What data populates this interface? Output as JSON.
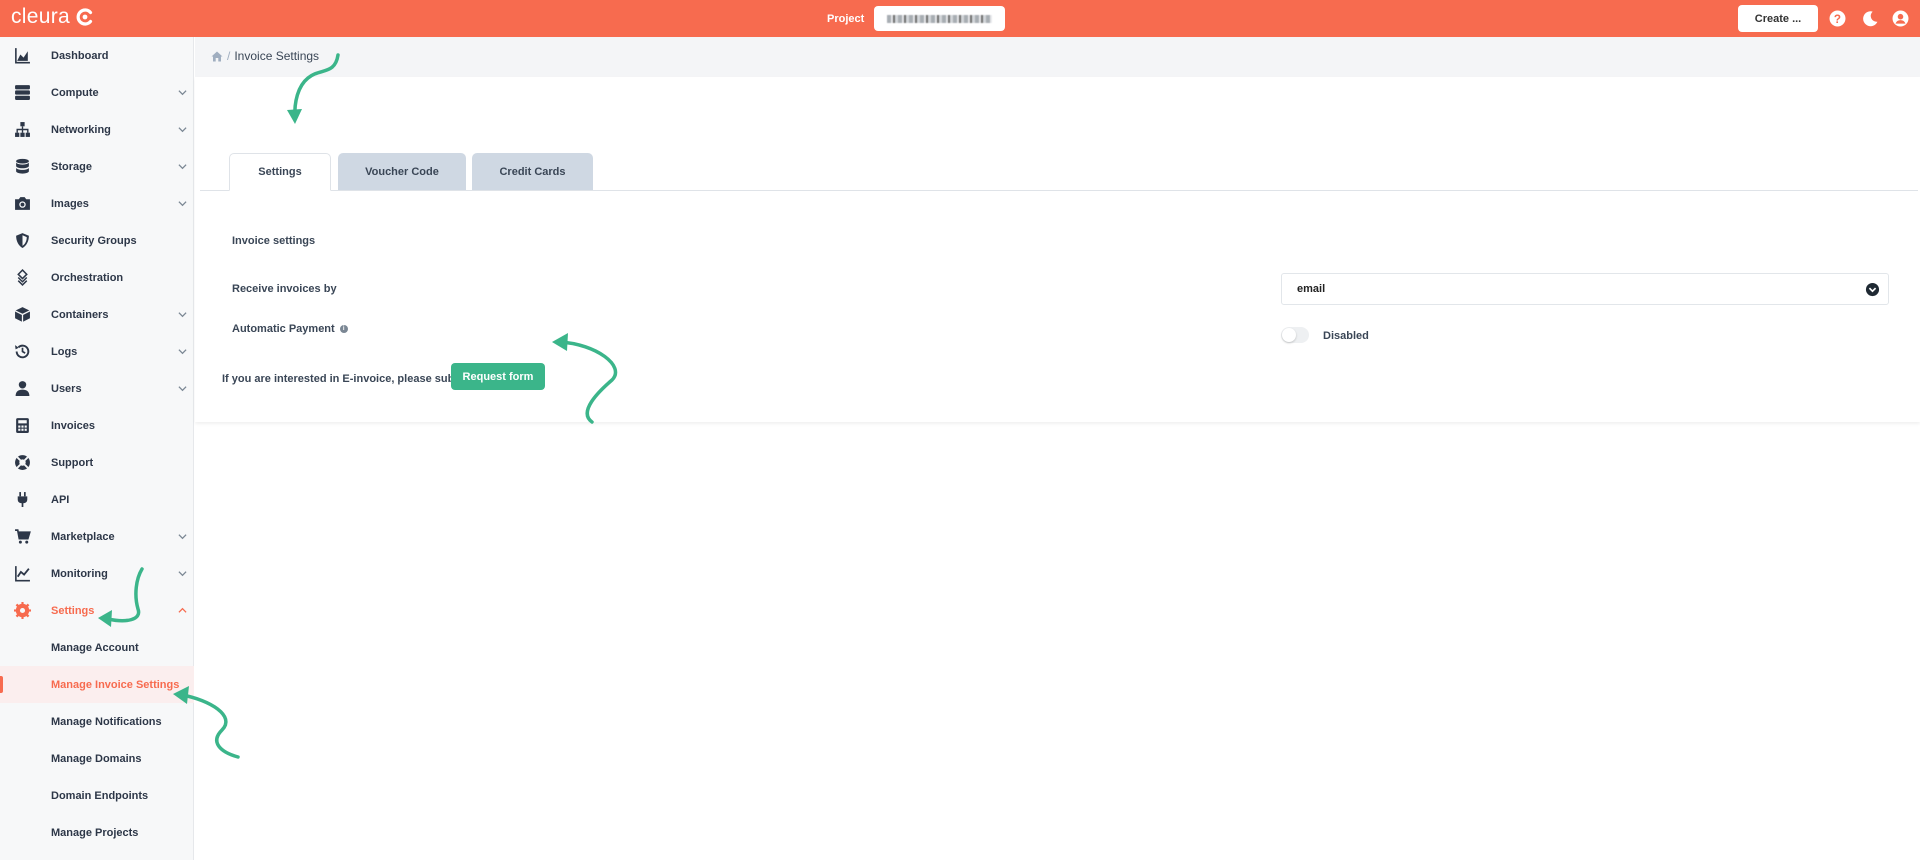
{
  "topbar": {
    "logo_text": "cleura",
    "project_label": "Project",
    "create_label": "Create ...",
    "icons": [
      "help-icon",
      "moon-icon",
      "user-icon"
    ],
    "brand_color": "#f76b4f"
  },
  "sidebar": {
    "items": [
      {
        "label": "Dashboard",
        "icon": "chart-area-icon",
        "has_chevron": false
      },
      {
        "label": "Compute",
        "icon": "server-icon",
        "has_chevron": true
      },
      {
        "label": "Networking",
        "icon": "network-icon",
        "has_chevron": true
      },
      {
        "label": "Storage",
        "icon": "database-icon",
        "has_chevron": true
      },
      {
        "label": "Images",
        "icon": "camera-icon",
        "has_chevron": true
      },
      {
        "label": "Security Groups",
        "icon": "shield-icon",
        "has_chevron": false
      },
      {
        "label": "Orchestration",
        "icon": "layers-icon",
        "has_chevron": false
      },
      {
        "label": "Containers",
        "icon": "cube-icon",
        "has_chevron": true
      },
      {
        "label": "Logs",
        "icon": "history-icon",
        "has_chevron": true
      },
      {
        "label": "Users",
        "icon": "user-icon",
        "has_chevron": true
      },
      {
        "label": "Invoices",
        "icon": "calculator-icon",
        "has_chevron": false
      },
      {
        "label": "Support",
        "icon": "lifebuoy-icon",
        "has_chevron": false
      },
      {
        "label": "API",
        "icon": "plug-icon",
        "has_chevron": false
      },
      {
        "label": "Marketplace",
        "icon": "cart-icon",
        "has_chevron": true
      },
      {
        "label": "Monitoring",
        "icon": "chart-line-icon",
        "has_chevron": true
      },
      {
        "label": "Settings",
        "icon": "gear-icon",
        "has_chevron": true,
        "active": true
      }
    ],
    "settings_sub": [
      {
        "label": "Manage Account"
      },
      {
        "label": "Manage Invoice Settings",
        "active": true
      },
      {
        "label": "Manage Notifications"
      },
      {
        "label": "Manage Domains"
      },
      {
        "label": "Domain Endpoints"
      },
      {
        "label": "Manage Projects"
      }
    ]
  },
  "breadcrumb": {
    "home_icon": "home-icon",
    "separator": "/",
    "current": "Invoice Settings"
  },
  "tabs": [
    {
      "label": "Settings",
      "active": true
    },
    {
      "label": "Voucher Code",
      "active": false
    },
    {
      "label": "Credit Cards",
      "active": false
    }
  ],
  "form": {
    "section_title": "Invoice settings",
    "receive_label": "Receive invoices by",
    "receive_value": "email",
    "auto_payment_label": "Automatic Payment",
    "auto_payment_status": "Disabled",
    "auto_payment_enabled": false,
    "einvoice_text": "If you are interested in E-invoice, please submit",
    "request_button": "Request form"
  },
  "colors": {
    "accent": "#f76b4f",
    "success": "#3bb58a",
    "annotation_arrow": "#3bb58a"
  }
}
